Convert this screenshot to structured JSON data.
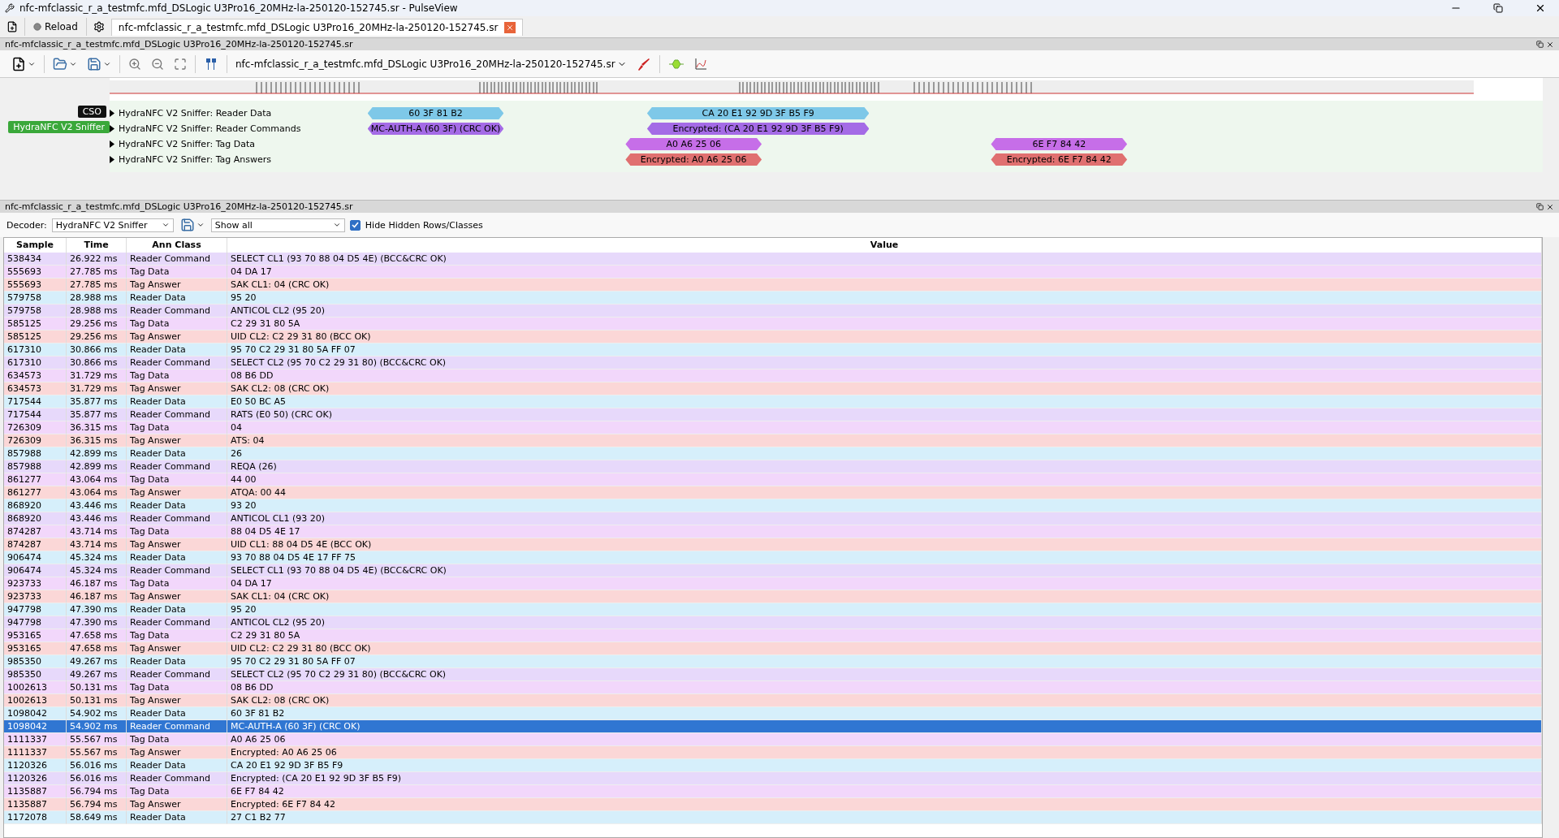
{
  "window": {
    "title": "nfc-mfclassic_r_a_testmfc.mfd_DSLogic U3Pro16_20MHz-la-250120-152745.sr - PulseView"
  },
  "tabbar": {
    "reload": "Reload",
    "tabs": [
      {
        "label": "nfc-mfclassic_r_a_testmfc.mfd_DSLogic U3Pro16_20MHz-la-250120-152745.sr",
        "selected": true
      }
    ]
  },
  "trace_view": {
    "title": "nfc-mfclassic_r_a_testmfc.mfd_DSLogic U3Pro16_20MHz-la-250120-152745.sr",
    "device": "nfc-mfclassic_r_a_testmfc.mfd_DSLogic U3Pro16_20MHz-la-250120-152745.sr",
    "signals": [
      {
        "label": "CSO",
        "kind": "channel"
      },
      {
        "label": "HydraNFC V2 Sniffer",
        "kind": "decoder"
      }
    ],
    "traces": [
      {
        "label": "HydraNFC V2 Sniffer: Reader Data",
        "kind": "reader-data",
        "annotations": [
          "60 3F 81 B2",
          "CA 20 E1 92 9D 3F B5 F9"
        ]
      },
      {
        "label": "HydraNFC V2 Sniffer: Reader Commands",
        "kind": "reader-command",
        "annotations": [
          "MC-AUTH-A (60 3F) (CRC OK)",
          "Encrypted:  (CA 20 E1 92 9D 3F B5 F9)"
        ]
      },
      {
        "label": "HydraNFC V2 Sniffer: Tag Data",
        "kind": "tag-data",
        "annotations": [
          "A0 A6 25 06",
          "6E F7 84 42"
        ]
      },
      {
        "label": "HydraNFC V2 Sniffer: Tag Answers",
        "kind": "tag-answer",
        "annotations": [
          "Encrypted: A0 A6 25 06",
          "Encrypted: 6E F7 84 42"
        ]
      }
    ]
  },
  "table_view": {
    "title": "nfc-mfclassic_r_a_testmfc.mfd_DSLogic U3Pro16_20MHz-la-250120-152745.sr",
    "decoder_label": "Decoder:",
    "decoder": "HydraNFC V2 Sniffer",
    "filter": "Show all",
    "hide_hidden": {
      "label": "Hide Hidden Rows/Classes",
      "checked": true
    },
    "columns": [
      "Sample",
      "Time",
      "Ann Class",
      "Value"
    ],
    "rows": [
      {
        "kind": "reader-command",
        "selected": false,
        "cells": [
          "538434",
          "26.922 ms",
          "Reader Command",
          "SELECT CL1 (93 70 88 04 D5 4E) (BCC&CRC OK)"
        ]
      },
      {
        "kind": "tag-data",
        "selected": false,
        "cells": [
          "555693",
          "27.785 ms",
          "Tag Data",
          "04 DA 17"
        ]
      },
      {
        "kind": "tag-answer",
        "selected": false,
        "cells": [
          "555693",
          "27.785 ms",
          "Tag Answer",
          "SAK CL1: 04 (CRC OK)"
        ]
      },
      {
        "kind": "reader-data",
        "selected": false,
        "cells": [
          "579758",
          "28.988 ms",
          "Reader Data",
          "95 20"
        ]
      },
      {
        "kind": "reader-command",
        "selected": false,
        "cells": [
          "579758",
          "28.988 ms",
          "Reader Command",
          "ANTICOL CL2 (95 20)"
        ]
      },
      {
        "kind": "tag-data",
        "selected": false,
        "cells": [
          "585125",
          "29.256 ms",
          "Tag Data",
          "C2 29 31 80 5A"
        ]
      },
      {
        "kind": "tag-answer",
        "selected": false,
        "cells": [
          "585125",
          "29.256 ms",
          "Tag Answer",
          "UID CL2: C2 29 31 80 (BCC OK)"
        ]
      },
      {
        "kind": "reader-data",
        "selected": false,
        "cells": [
          "617310",
          "30.866 ms",
          "Reader Data",
          "95 70 C2 29 31 80 5A FF 07"
        ]
      },
      {
        "kind": "reader-command",
        "selected": false,
        "cells": [
          "617310",
          "30.866 ms",
          "Reader Command",
          "SELECT CL2 (95 70 C2 29 31 80) (BCC&CRC OK)"
        ]
      },
      {
        "kind": "tag-data",
        "selected": false,
        "cells": [
          "634573",
          "31.729 ms",
          "Tag Data",
          "08 B6 DD"
        ]
      },
      {
        "kind": "tag-answer",
        "selected": false,
        "cells": [
          "634573",
          "31.729 ms",
          "Tag Answer",
          "SAK CL2: 08 (CRC OK)"
        ]
      },
      {
        "kind": "reader-data",
        "selected": false,
        "cells": [
          "717544",
          "35.877 ms",
          "Reader Data",
          "E0 50 BC A5"
        ]
      },
      {
        "kind": "reader-command",
        "selected": false,
        "cells": [
          "717544",
          "35.877 ms",
          "Reader Command",
          "RATS (E0 50) (CRC OK)"
        ]
      },
      {
        "kind": "tag-data",
        "selected": false,
        "cells": [
          "726309",
          "36.315 ms",
          "Tag Data",
          "04"
        ]
      },
      {
        "kind": "tag-answer",
        "selected": false,
        "cells": [
          "726309",
          "36.315 ms",
          "Tag Answer",
          "ATS: 04"
        ]
      },
      {
        "kind": "reader-data",
        "selected": false,
        "cells": [
          "857988",
          "42.899 ms",
          "Reader Data",
          "26"
        ]
      },
      {
        "kind": "reader-command",
        "selected": false,
        "cells": [
          "857988",
          "42.899 ms",
          "Reader Command",
          "REQA (26)"
        ]
      },
      {
        "kind": "tag-data",
        "selected": false,
        "cells": [
          "861277",
          "43.064 ms",
          "Tag Data",
          "44 00"
        ]
      },
      {
        "kind": "tag-answer",
        "selected": false,
        "cells": [
          "861277",
          "43.064 ms",
          "Tag Answer",
          "ATQA: 00 44"
        ]
      },
      {
        "kind": "reader-data",
        "selected": false,
        "cells": [
          "868920",
          "43.446 ms",
          "Reader Data",
          "93 20"
        ]
      },
      {
        "kind": "reader-command",
        "selected": false,
        "cells": [
          "868920",
          "43.446 ms",
          "Reader Command",
          "ANTICOL CL1 (93 20)"
        ]
      },
      {
        "kind": "tag-data",
        "selected": false,
        "cells": [
          "874287",
          "43.714 ms",
          "Tag Data",
          "88 04 D5 4E 17"
        ]
      },
      {
        "kind": "tag-answer",
        "selected": false,
        "cells": [
          "874287",
          "43.714 ms",
          "Tag Answer",
          "UID CL1: 88 04 D5 4E (BCC OK)"
        ]
      },
      {
        "kind": "reader-data",
        "selected": false,
        "cells": [
          "906474",
          "45.324 ms",
          "Reader Data",
          "93 70 88 04 D5 4E 17 FF 75"
        ]
      },
      {
        "kind": "reader-command",
        "selected": false,
        "cells": [
          "906474",
          "45.324 ms",
          "Reader Command",
          "SELECT CL1 (93 70 88 04 D5 4E) (BCC&CRC OK)"
        ]
      },
      {
        "kind": "tag-data",
        "selected": false,
        "cells": [
          "923733",
          "46.187 ms",
          "Tag Data",
          "04 DA 17"
        ]
      },
      {
        "kind": "tag-answer",
        "selected": false,
        "cells": [
          "923733",
          "46.187 ms",
          "Tag Answer",
          "SAK CL1: 04 (CRC OK)"
        ]
      },
      {
        "kind": "reader-data",
        "selected": false,
        "cells": [
          "947798",
          "47.390 ms",
          "Reader Data",
          "95 20"
        ]
      },
      {
        "kind": "reader-command",
        "selected": false,
        "cells": [
          "947798",
          "47.390 ms",
          "Reader Command",
          "ANTICOL CL2 (95 20)"
        ]
      },
      {
        "kind": "tag-data",
        "selected": false,
        "cells": [
          "953165",
          "47.658 ms",
          "Tag Data",
          "C2 29 31 80 5A"
        ]
      },
      {
        "kind": "tag-answer",
        "selected": false,
        "cells": [
          "953165",
          "47.658 ms",
          "Tag Answer",
          "UID CL2: C2 29 31 80 (BCC OK)"
        ]
      },
      {
        "kind": "reader-data",
        "selected": false,
        "cells": [
          "985350",
          "49.267 ms",
          "Reader Data",
          "95 70 C2 29 31 80 5A FF 07"
        ]
      },
      {
        "kind": "reader-command",
        "selected": false,
        "cells": [
          "985350",
          "49.267 ms",
          "Reader Command",
          "SELECT CL2 (95 70 C2 29 31 80) (BCC&CRC OK)"
        ]
      },
      {
        "kind": "tag-data",
        "selected": false,
        "cells": [
          "1002613",
          "50.131 ms",
          "Tag Data",
          "08 B6 DD"
        ]
      },
      {
        "kind": "tag-answer",
        "selected": false,
        "cells": [
          "1002613",
          "50.131 ms",
          "Tag Answer",
          "SAK CL2: 08 (CRC OK)"
        ]
      },
      {
        "kind": "reader-data",
        "selected": false,
        "cells": [
          "1098042",
          "54.902 ms",
          "Reader Data",
          "60 3F 81 B2"
        ]
      },
      {
        "kind": "reader-command",
        "selected": true,
        "cells": [
          "1098042",
          "54.902 ms",
          "Reader Command",
          "MC-AUTH-A (60 3F) (CRC OK)"
        ]
      },
      {
        "kind": "tag-data",
        "selected": false,
        "cells": [
          "1111337",
          "55.567 ms",
          "Tag Data",
          "A0 A6 25 06"
        ]
      },
      {
        "kind": "tag-answer",
        "selected": false,
        "cells": [
          "1111337",
          "55.567 ms",
          "Tag Answer",
          "Encrypted: A0 A6 25 06"
        ]
      },
      {
        "kind": "reader-data",
        "selected": false,
        "cells": [
          "1120326",
          "56.016 ms",
          "Reader Data",
          "CA 20 E1 92 9D 3F B5 F9"
        ]
      },
      {
        "kind": "reader-command",
        "selected": false,
        "cells": [
          "1120326",
          "56.016 ms",
          "Reader Command",
          "Encrypted:  (CA 20 E1 92 9D 3F B5 F9)"
        ]
      },
      {
        "kind": "tag-data",
        "selected": false,
        "cells": [
          "1135887",
          "56.794 ms",
          "Tag Data",
          "6E F7 84 42"
        ]
      },
      {
        "kind": "tag-answer",
        "selected": false,
        "cells": [
          "1135887",
          "56.794 ms",
          "Tag Answer",
          "Encrypted: 6E F7 84 42"
        ]
      },
      {
        "kind": "reader-data",
        "selected": false,
        "cells": [
          "1172078",
          "58.649 ms",
          "Reader Data",
          "27 C1 B2 77"
        ]
      }
    ]
  }
}
